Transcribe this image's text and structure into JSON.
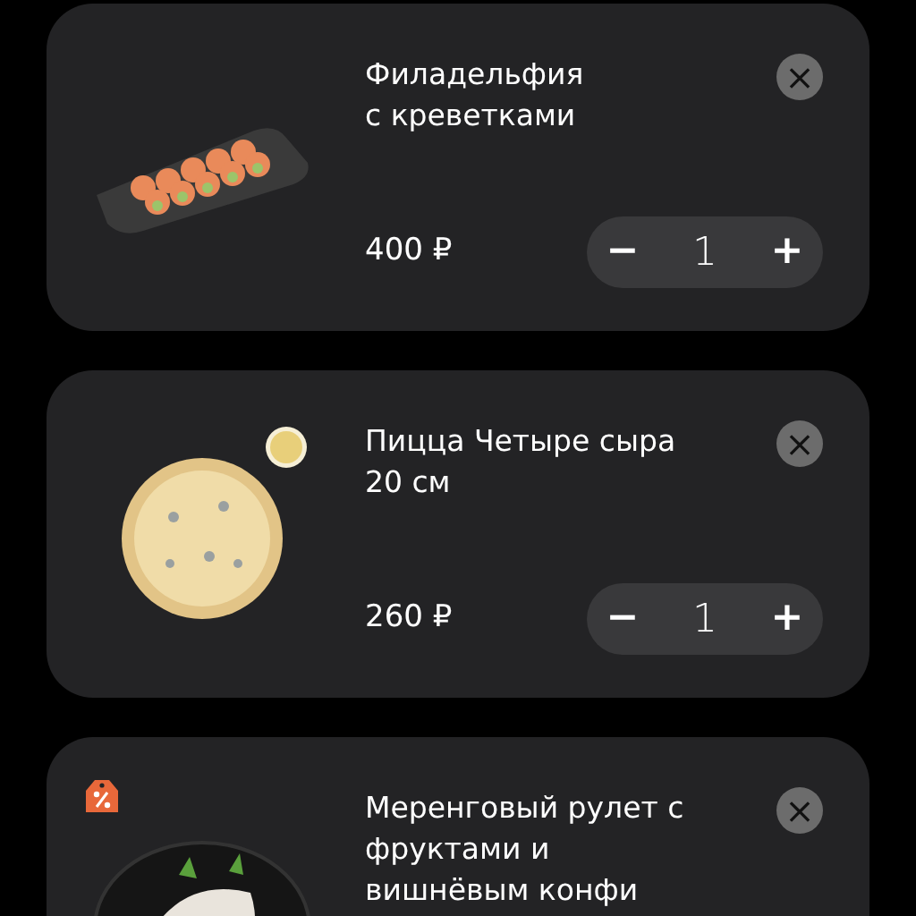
{
  "cart_items": [
    {
      "title": "Филадельфия\nс креветками",
      "kind": "sushi",
      "price": "400 ₽",
      "quantity": "1",
      "minus": "−",
      "plus": "+",
      "remove": "×"
    },
    {
      "title": "Пицца Четыре сыра\n20 см",
      "kind": "pizza",
      "badge": {
        "kind": "sauce"
      },
      "price": "260 ₽",
      "quantity": "1",
      "minus": "−",
      "plus": "+",
      "remove": "×"
    },
    {
      "title": "Меренговый рулет с\nфруктами и\nвишнёвым конфи",
      "kind": "dessert",
      "badge": {
        "kind": "discount"
      },
      "remove": "×"
    }
  ]
}
